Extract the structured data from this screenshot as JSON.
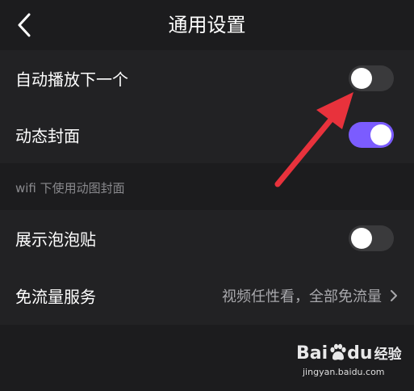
{
  "header": {
    "title": "通用设置",
    "back_icon": "chevron-left-icon"
  },
  "settings": {
    "autoplay": {
      "label": "自动播放下一个",
      "enabled": false
    },
    "dynamic_cover": {
      "label": "动态封面",
      "enabled": true
    },
    "dynamic_cover_note": "wifi 下使用动图封面",
    "bubble_stickers": {
      "label": "展示泡泡贴",
      "enabled": false
    },
    "free_data": {
      "label": "免流量服务",
      "value": "视频任性看，全部免流量",
      "chevron_icon": "chevron-right-icon"
    }
  },
  "watermark": {
    "logo_text": "Bai",
    "logo_text_2": "du",
    "logo_text_3": "经验",
    "url": "jingyan.baidu.com"
  },
  "colors": {
    "background": "#1c1c1e",
    "toggle_on": "#7b5cff",
    "toggle_off": "#3a3a3c",
    "annotation_arrow": "#e8323c"
  }
}
